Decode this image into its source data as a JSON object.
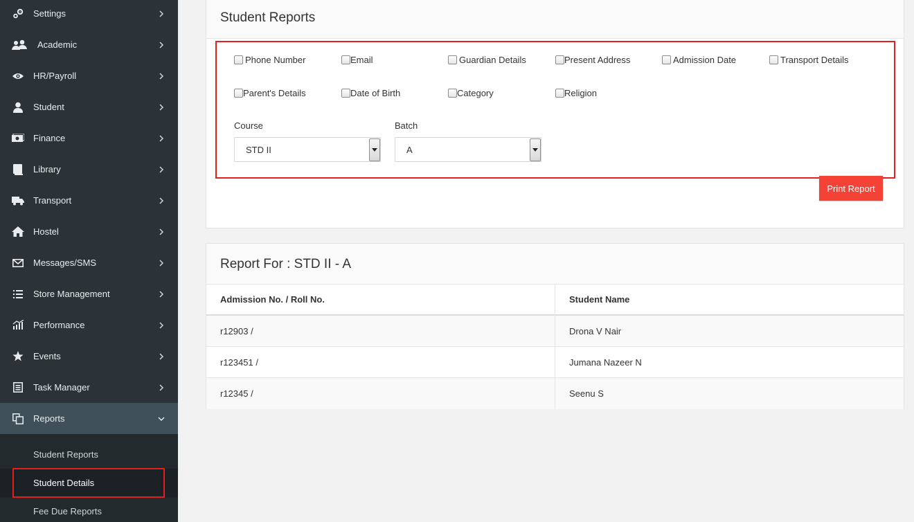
{
  "sidebar": {
    "items": [
      {
        "label": "Settings",
        "icon": "gears-icon"
      },
      {
        "label": "Academic",
        "icon": "users-icon"
      },
      {
        "label": "HR/Payroll",
        "icon": "eye-icon"
      },
      {
        "label": "Student",
        "icon": "user-icon"
      },
      {
        "label": "Finance",
        "icon": "money-icon"
      },
      {
        "label": "Library",
        "icon": "book-icon"
      },
      {
        "label": "Transport",
        "icon": "truck-icon"
      },
      {
        "label": "Hostel",
        "icon": "home-icon"
      },
      {
        "label": "Messages/SMS",
        "icon": "envelope-icon"
      },
      {
        "label": "Store Management",
        "icon": "list-icon"
      },
      {
        "label": "Performance",
        "icon": "bar-chart-icon"
      },
      {
        "label": "Events",
        "icon": "star-icon"
      },
      {
        "label": "Task Manager",
        "icon": "task-icon"
      },
      {
        "label": "Reports",
        "icon": "copy-icon"
      }
    ],
    "reports_sub": [
      {
        "label": "Student Reports"
      },
      {
        "label": "Student Details"
      },
      {
        "label": "Fee Due Reports"
      }
    ]
  },
  "filter_panel": {
    "title": "Student Reports",
    "checkboxes": [
      "Phone Number",
      "Email",
      "Guardian Details",
      "Present Address",
      "Admission Date",
      "Transport Details",
      "Parent's Details",
      "Date of Birth",
      "Category",
      "Religion"
    ],
    "course_label": "Course",
    "course_value": "STD II",
    "batch_label": "Batch",
    "batch_value": "A",
    "print_button": "Print Report"
  },
  "report": {
    "title": "Report For : STD II - A",
    "columns": [
      "Admission No. / Roll No.",
      "Student Name"
    ],
    "rows": [
      [
        "r12903 /",
        "Drona V Nair"
      ],
      [
        "r123451 /",
        "Jumana Nazeer N"
      ],
      [
        "r12345 /",
        "Seenu S"
      ]
    ]
  },
  "colors": {
    "sidebar_bg": "#2b3338",
    "active_bg": "#405058",
    "print_button": "#f44336",
    "highlight": "#e32020"
  }
}
